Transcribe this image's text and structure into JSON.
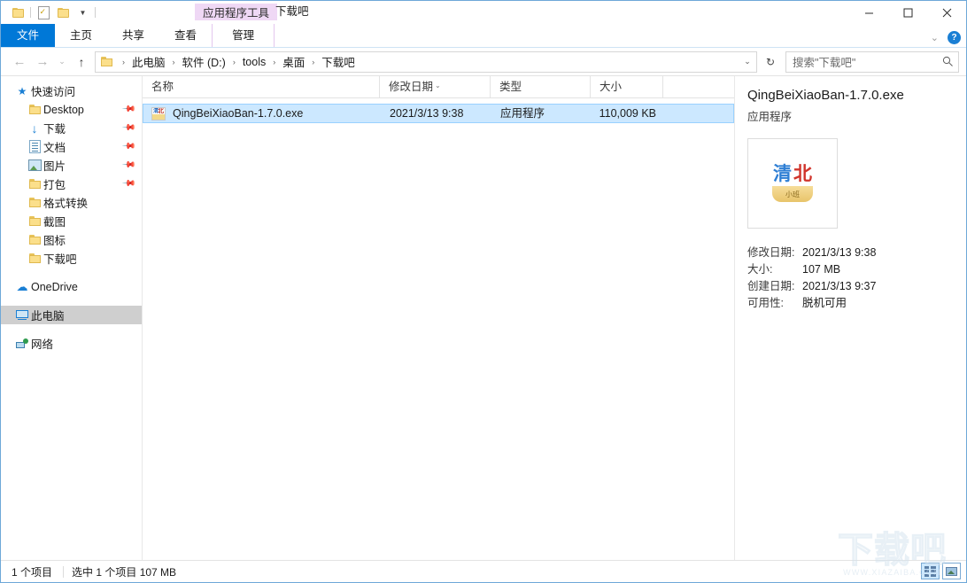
{
  "window": {
    "contextual_tab_group": "应用程序工具",
    "title": "下载吧",
    "quick_access": [
      "folder-icon",
      "properties-icon",
      "new-folder-icon",
      "customize-caret-icon"
    ],
    "controls": {
      "minimize": "minimize-icon",
      "maximize": "maximize-icon",
      "close": "close-icon"
    }
  },
  "ribbon": {
    "tabs": [
      {
        "label": "文件",
        "active_style": "file"
      },
      {
        "label": "主页"
      },
      {
        "label": "共享"
      },
      {
        "label": "查看"
      },
      {
        "label": "管理",
        "contextual": true
      }
    ],
    "collapse_icon": "chevron-down-icon",
    "help_icon": "help-icon",
    "help_label": "?"
  },
  "address": {
    "back_icon": "back-arrow-icon",
    "forward_icon": "forward-arrow-icon",
    "recent_icon": "recent-locations-icon",
    "up_icon": "up-arrow-icon",
    "breadcrumbs": [
      "此电脑",
      "软件 (D:)",
      "tools",
      "桌面",
      "下载吧"
    ],
    "separator": "›",
    "dropdown_icon": "address-dropdown-icon",
    "refresh_icon": "refresh-icon",
    "refresh_glyph": "↻"
  },
  "search": {
    "placeholder": "搜索\"下载吧\"",
    "icon": "search-icon"
  },
  "sidebar": {
    "items": [
      {
        "label": "快速访问",
        "icon": "star-icon",
        "level": "root",
        "pinned": false,
        "selected": false
      },
      {
        "label": "Desktop",
        "icon": "folder-icon",
        "level": "child",
        "pinned": true,
        "selected": false
      },
      {
        "label": "下载",
        "icon": "downloads-icon",
        "level": "child",
        "pinned": true,
        "selected": false
      },
      {
        "label": "文档",
        "icon": "documents-icon",
        "level": "child",
        "pinned": true,
        "selected": false
      },
      {
        "label": "图片",
        "icon": "pictures-icon",
        "level": "child",
        "pinned": true,
        "selected": false
      },
      {
        "label": "打包",
        "icon": "folder-icon",
        "level": "child",
        "pinned": true,
        "selected": false
      },
      {
        "label": "格式转换",
        "icon": "folder-icon",
        "level": "child",
        "pinned": false,
        "selected": false
      },
      {
        "label": "截图",
        "icon": "folder-icon",
        "level": "child",
        "pinned": false,
        "selected": false
      },
      {
        "label": "图标",
        "icon": "folder-icon",
        "level": "child",
        "pinned": false,
        "selected": false
      },
      {
        "label": "下载吧",
        "icon": "folder-icon",
        "level": "child",
        "pinned": false,
        "selected": false
      },
      {
        "label": "OneDrive",
        "icon": "cloud-icon",
        "level": "root",
        "pinned": false,
        "selected": false
      },
      {
        "label": "此电脑",
        "icon": "this-pc-icon",
        "level": "root",
        "pinned": false,
        "selected": true
      },
      {
        "label": "网络",
        "icon": "network-icon",
        "level": "root",
        "pinned": false,
        "selected": false
      }
    ]
  },
  "filelist": {
    "columns": [
      {
        "label": "名称",
        "key": "name",
        "sorted": false
      },
      {
        "label": "修改日期",
        "key": "date",
        "sorted": true,
        "sort_glyph": "⌄"
      },
      {
        "label": "类型",
        "key": "type",
        "sorted": false
      },
      {
        "label": "大小",
        "key": "size",
        "sorted": false
      }
    ],
    "rows": [
      {
        "name": "QingBeiXiaoBan-1.7.0.exe",
        "date": "2021/3/13 9:38",
        "type": "应用程序",
        "size": "110,009 KB",
        "icon": "exe-file-icon",
        "selected": true
      }
    ]
  },
  "details": {
    "title": "QingBeiXiaoBan-1.7.0.exe",
    "subtitle": "应用程序",
    "thumbnail": {
      "icon": "qingbei-logo-icon",
      "text_left": "清",
      "text_right": "北",
      "badge": "小班"
    },
    "metadata": [
      {
        "key": "修改日期:",
        "value": "2021/3/13 9:38"
      },
      {
        "key": "大小:",
        "value": "107 MB"
      },
      {
        "key": "创建日期:",
        "value": "2021/3/13 9:37"
      },
      {
        "key": "可用性:",
        "value": "脱机可用"
      }
    ]
  },
  "statusbar": {
    "item_count": "1 个项目",
    "selection": "选中 1 个项目  107 MB",
    "view_buttons": [
      {
        "name": "details-view-button",
        "icon": "details-view-icon",
        "active": true
      },
      {
        "name": "large-icons-view-button",
        "icon": "large-icons-view-icon",
        "active": false
      }
    ]
  },
  "watermark": {
    "text": "下载吧",
    "url": "WWW.XIAZAIBA.COM"
  },
  "colors": {
    "accent": "#0078d7",
    "selection": "#cce8ff",
    "contextual_tab": "#efd8f5",
    "nav_selected": "#cfcfcf"
  }
}
